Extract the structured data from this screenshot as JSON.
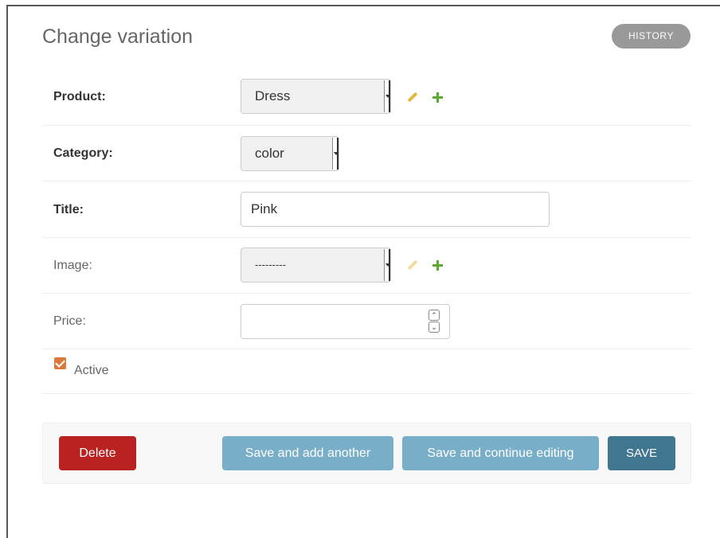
{
  "page": {
    "title": "Change variation",
    "history_label": "HISTORY"
  },
  "form": {
    "product": {
      "label": "Product:",
      "value": "Dress"
    },
    "category": {
      "label": "Category:",
      "value": "color"
    },
    "title": {
      "label": "Title:",
      "value": "Pink"
    },
    "image": {
      "label": "Image:",
      "value": "---------"
    },
    "price": {
      "label": "Price:",
      "value": ""
    },
    "active": {
      "label": "Active",
      "checked": true
    }
  },
  "icons": {
    "edit": "pencil-icon",
    "add": "plus-icon"
  },
  "buttons": {
    "delete": "Delete",
    "save_add_another": "Save and add another",
    "save_continue": "Save and continue editing",
    "save": "SAVE"
  },
  "colors": {
    "delete": "#ba2121",
    "secondary": "#79aec8",
    "primary": "#417690",
    "history": "#999999",
    "checkbox": "#d97a3a",
    "add_icon": "#5aab2e",
    "edit_icon": "#e4b83b"
  }
}
